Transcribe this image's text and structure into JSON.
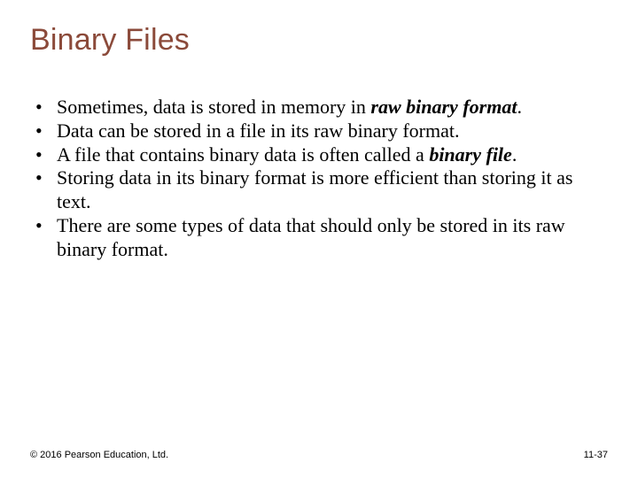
{
  "slide": {
    "title": "Binary Files",
    "bullets": {
      "b1a": "Sometimes, data is stored in memory in ",
      "b1b": "raw binary format",
      "b1c": ".",
      "b2": "Data can be stored in a file in its raw binary format.",
      "b3a": "A file that contains binary data is often called a ",
      "b3b": "binary file",
      "b3c": ".",
      "b4": "Storing data in its binary format is more efficient than storing it as text.",
      "b5": "There are some types of data that should only be stored in its raw binary format."
    },
    "footer": {
      "copyright": "© 2016 Pearson Education, Ltd.",
      "pagenum": "11-37"
    }
  }
}
